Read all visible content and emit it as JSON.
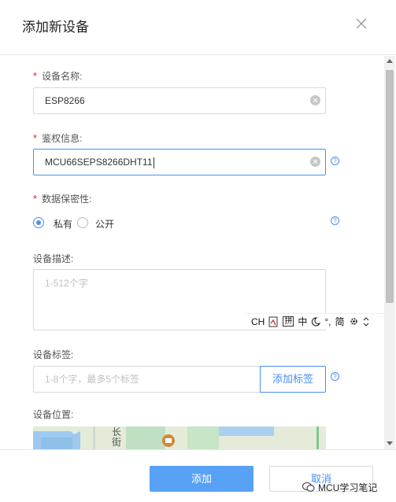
{
  "dialog": {
    "title": "添加新设备",
    "close_icon": "close-icon"
  },
  "form": {
    "device_name": {
      "label": "设备名称:",
      "required_mark": "*",
      "value": "ESP8266"
    },
    "auth_info": {
      "label": "鉴权信息:",
      "required_mark": "*",
      "value": "MCU66SEPS8266DHT11",
      "help_icon": "?"
    },
    "privacy": {
      "label": "数据保密性:",
      "required_mark": "*",
      "options": [
        "私有",
        "公开"
      ],
      "selected": "私有",
      "help_icon": "?"
    },
    "description": {
      "label": "设备描述:",
      "placeholder": "1-512个字"
    },
    "tags": {
      "label": "设备标签:",
      "placeholder": "1-8个字，最多5个标签",
      "add_button": "添加标签",
      "help_icon": "?"
    },
    "location": {
      "label": "设备位置:",
      "map_text": "长街"
    }
  },
  "ime_toolbar": {
    "items": [
      "CH",
      "拼",
      "中",
      "°,",
      "简"
    ]
  },
  "footer": {
    "confirm": "添加",
    "cancel": "取消"
  },
  "watermark": {
    "text": "MCU学习笔记"
  },
  "colors": {
    "accent": "#4a8ef5",
    "primary_button": "#58a2f5",
    "required": "#e02020"
  }
}
